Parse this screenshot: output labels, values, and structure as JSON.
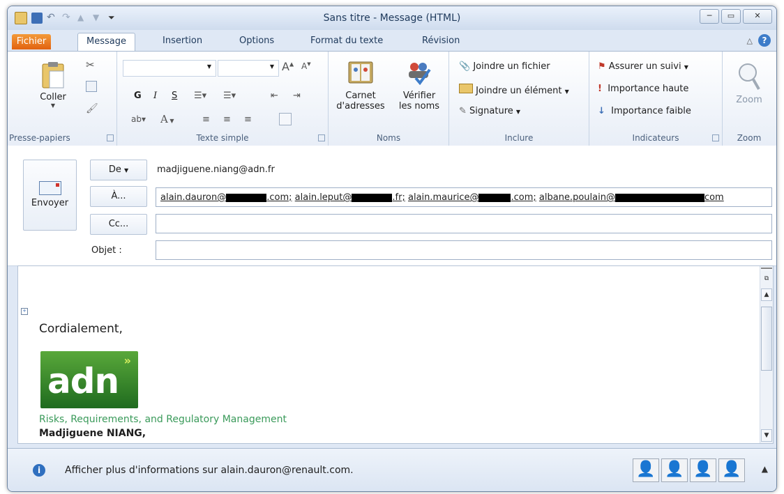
{
  "window": {
    "title": "Sans titre - Message (HTML)"
  },
  "tabs": [
    "Fichier",
    "Message",
    "Insertion",
    "Options",
    "Format du texte",
    "Révision"
  ],
  "ribbon": {
    "clipboard": {
      "paste": "Coller",
      "label": "Presse-papiers"
    },
    "basic_text": {
      "label": "Texte simple",
      "bold": "G",
      "italic": "I",
      "underline": "S",
      "font_color": "A"
    },
    "names": {
      "address_book_1": "Carnet",
      "address_book_2": "d'adresses",
      "check_1": "Vérifier",
      "check_2": "les noms",
      "label": "Noms"
    },
    "include": {
      "attach_file": "Joindre un fichier",
      "attach_item": "Joindre un élément",
      "signature": "Signature",
      "label": "Inclure"
    },
    "tags": {
      "follow_up": "Assurer un suivi",
      "high": "Importance haute",
      "low": "Importance faible",
      "label": "Indicateurs"
    },
    "zoom": {
      "button": "Zoom",
      "label": "Zoom"
    }
  },
  "compose": {
    "send": "Envoyer",
    "from_btn": "De",
    "from_value": "madjiguene.niang@adn.fr",
    "to_btn": "À...",
    "to_parts": [
      "alain.dauron@",
      ".com;",
      "alain.leput@",
      ".fr;",
      "alain.maurice@",
      ".com;",
      "albane.poulain@",
      "com"
    ],
    "cc_btn": "Cc...",
    "subject_label": "Objet :"
  },
  "body": {
    "greeting": "Cordialement,",
    "logo_text": "adn",
    "tagline": "Risks, Requirements, and Regulatory Management",
    "name": "Madjiguene NIANG,"
  },
  "status": {
    "info": "Afficher plus d'informations sur alain.dauron@renault.com."
  },
  "colors": {
    "file_tab": "#e2620f",
    "logo_green": "#2e8b2e",
    "tagline_green": "#3a9a5a"
  }
}
